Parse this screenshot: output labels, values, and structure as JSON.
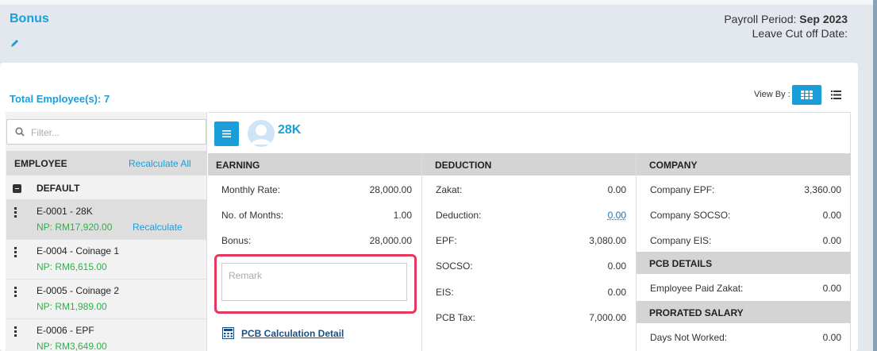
{
  "header": {
    "title": "Bonus",
    "payroll_period_label": "Payroll Period:",
    "payroll_period_value": "Sep 2023",
    "leave_cutoff_label": "Leave Cut off Date:"
  },
  "toolbar": {
    "total_employees": "Total Employee(s): 7",
    "view_by_label": "View By :"
  },
  "employee_list": {
    "filter_placeholder": "Filter...",
    "header_label": "EMPLOYEE",
    "recalculate_all": "Recalculate All",
    "group_name": "DEFAULT",
    "items": [
      {
        "name": "E-0001 - 28K",
        "np": "NP: RM17,920.00",
        "recalc": "Recalculate"
      },
      {
        "name": "E-0004 - Coinage 1",
        "np": "NP: RM6,615.00"
      },
      {
        "name": "E-0005 - Coinage 2",
        "np": "NP: RM1,989.00"
      },
      {
        "name": "E-0006 - EPF",
        "np": "NP: RM3,649.00"
      }
    ]
  },
  "detail": {
    "employee_title": "28K",
    "earning": {
      "heading": "EARNING",
      "rows": [
        {
          "label": "Monthly Rate:",
          "value": "28,000.00"
        },
        {
          "label": "No. of Months:",
          "value": "1.00"
        },
        {
          "label": "Bonus:",
          "value": "28,000.00"
        }
      ],
      "remark_placeholder": "Remark",
      "pcb_link": "PCB Calculation Detail"
    },
    "deduction": {
      "heading": "DEDUCTION",
      "rows": [
        {
          "label": "Zakat:",
          "value": "0.00"
        },
        {
          "label": "Deduction:",
          "value": "0.00"
        },
        {
          "label": "EPF:",
          "value": "3,080.00"
        },
        {
          "label": "SOCSO:",
          "value": "0.00"
        },
        {
          "label": "EIS:",
          "value": "0.00"
        },
        {
          "label": "PCB Tax:",
          "value": "7,000.00"
        }
      ]
    },
    "company": {
      "heading": "COMPANY",
      "rows": [
        {
          "label": "Company EPF:",
          "value": "3,360.00"
        },
        {
          "label": "Company SOCSO:",
          "value": "0.00"
        },
        {
          "label": "Company EIS:",
          "value": "0.00"
        }
      ],
      "pcb_heading": "PCB DETAILS",
      "pcb_rows": [
        {
          "label": "Employee Paid Zakat:",
          "value": "0.00"
        }
      ],
      "prorated_heading": "PRORATED SALARY",
      "prorated_rows": [
        {
          "label": "Days Not Worked:",
          "value": "0.00"
        }
      ]
    }
  },
  "colors": {
    "accent": "#1a9ed9",
    "np_green": "#2ab24a",
    "highlight": "#e8375f"
  }
}
